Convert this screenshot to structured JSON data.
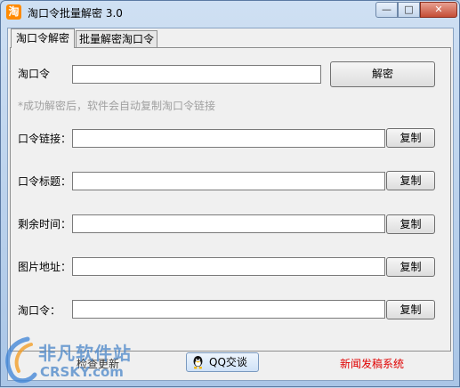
{
  "window": {
    "title": "淘口令批量解密 3.0",
    "app_icon_glyph": "淘",
    "controls": {
      "minimize": "—",
      "maximize": "□",
      "close": "✕"
    }
  },
  "tabs": [
    {
      "label": "淘口令解密",
      "active": true
    },
    {
      "label": "批量解密淘口令",
      "active": false
    }
  ],
  "form": {
    "taokouling_label": "淘口令",
    "decrypt_button": "解密",
    "hint": "*成功解密后，软件会自动复制淘口令链接",
    "fields": [
      {
        "label": "口令链接：",
        "value": "",
        "copy_label": "复制"
      },
      {
        "label": "口令标题：",
        "value": "",
        "copy_label": "复制"
      },
      {
        "label": "剩余时间：",
        "value": "",
        "copy_label": "复制"
      },
      {
        "label": "图片地址：",
        "value": "",
        "copy_label": "复制"
      },
      {
        "label": "淘口令：",
        "value": "",
        "copy_label": "复制"
      }
    ]
  },
  "footer": {
    "check_update": "检查更新",
    "qq_label": "QQ交谈",
    "news_link": "新闻发稿系统"
  },
  "watermark": {
    "line1": "非凡软件站",
    "line2": "CRSKY.com"
  },
  "colors": {
    "link_red": "#e00000",
    "title_bg": "#cfe0f3",
    "client_bg": "#f0f0f0"
  }
}
